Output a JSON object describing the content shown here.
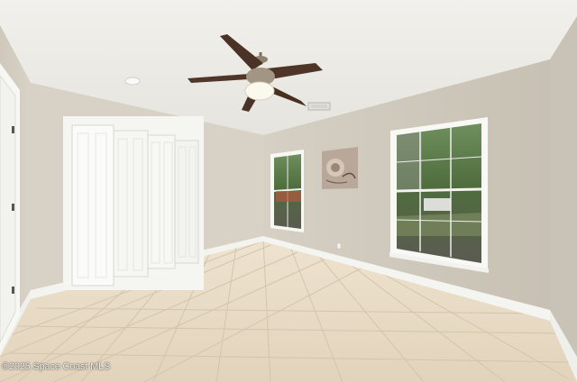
{
  "photo": {
    "watermark": "©2025 Space Coast MLS"
  },
  "colors": {
    "ceiling": "#f3f2ee",
    "wall_left": "#d8d2c7",
    "wall_back": "#d3cdc1",
    "wall_right": "#ccc6ba",
    "trim": "#f5f5f2",
    "floor_tile": "#e9dcc6",
    "grout": "#cdbfa8"
  }
}
